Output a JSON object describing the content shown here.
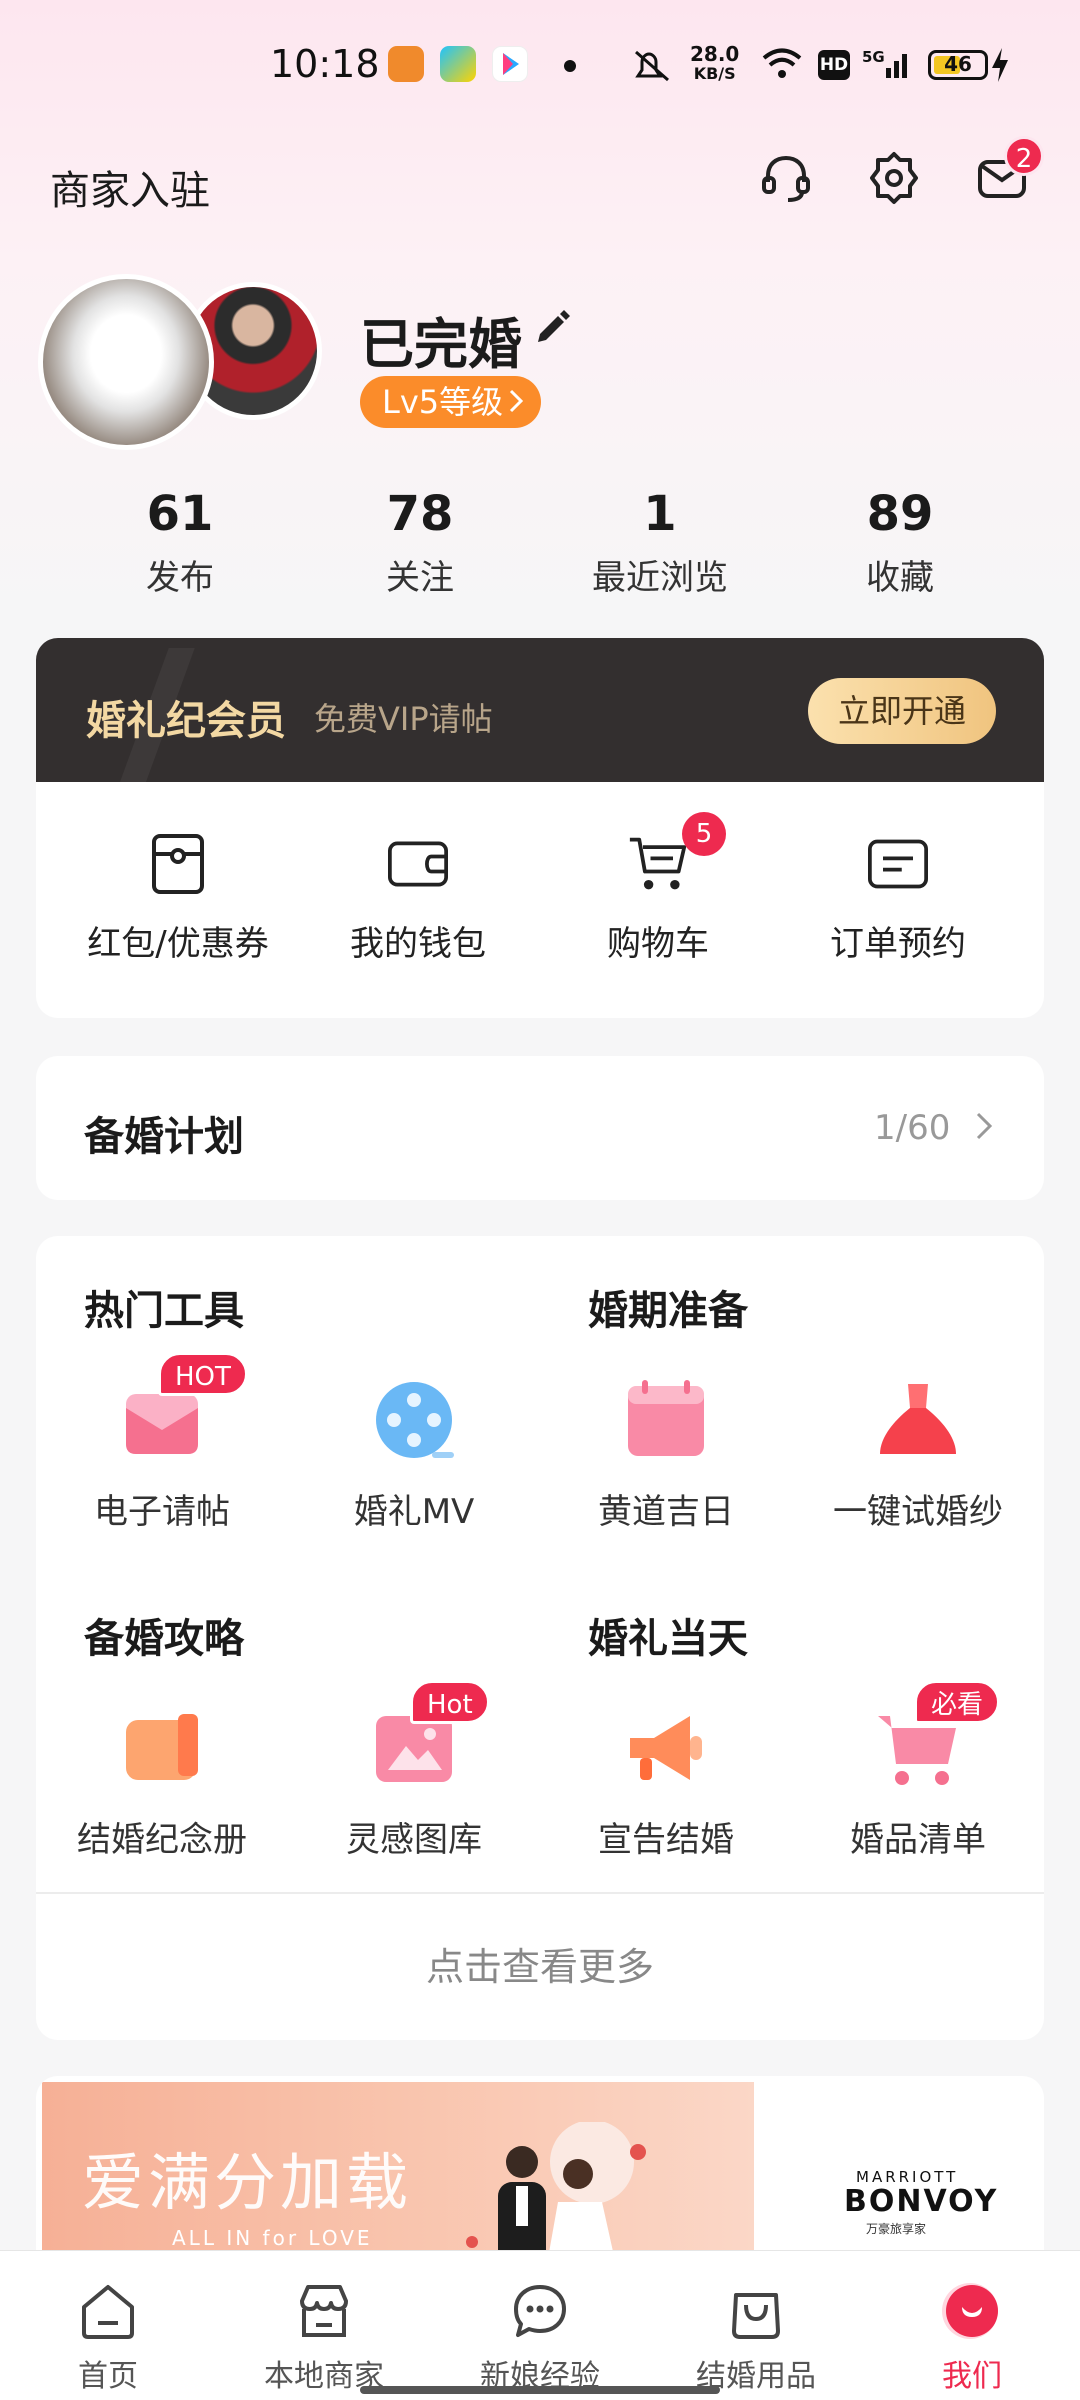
{
  "status_bar": {
    "time": "10:18",
    "net_speed_value": "28.0",
    "net_speed_unit": "KB/S",
    "hd": "HD",
    "battery": "46",
    "icons": [
      "uc-browser-icon",
      "video-app-icon",
      "youku-icon",
      "mute-icon",
      "wifi-icon",
      "5g-signal-icon",
      "charging-icon"
    ]
  },
  "header": {
    "merchant_link": "商家入驻",
    "message_badge": "2"
  },
  "profile": {
    "nickname": "已完婚",
    "level": "Lv5等级"
  },
  "stats": [
    {
      "value": "61",
      "label": "发布"
    },
    {
      "value": "78",
      "label": "关注"
    },
    {
      "value": "1",
      "label": "最近浏览"
    },
    {
      "value": "89",
      "label": "收藏"
    }
  ],
  "vip": {
    "title": "婚礼纪会员",
    "subtitle": "免费VIP请帖",
    "button": "立即开通"
  },
  "wallet": {
    "items": [
      {
        "label": "红包/优惠券",
        "icon": "coupon-icon"
      },
      {
        "label": "我的钱包",
        "icon": "wallet-icon"
      },
      {
        "label": "购物车",
        "icon": "cart-icon"
      },
      {
        "label": "订单预约",
        "icon": "order-icon"
      }
    ],
    "cart_badge": "5"
  },
  "plan": {
    "title": "备婚计划",
    "progress": "1/60"
  },
  "tools": {
    "sections": [
      {
        "title": "热门工具"
      },
      {
        "title": "婚期准备"
      },
      {
        "title": "备婚攻略"
      },
      {
        "title": "婚礼当天"
      }
    ],
    "items": [
      {
        "label": "电子请帖",
        "badge": "HOT",
        "icon": "invitation-icon"
      },
      {
        "label": "婚礼MV",
        "badge": "",
        "icon": "film-reel-icon"
      },
      {
        "label": "黄道吉日",
        "badge": "",
        "icon": "calendar-icon"
      },
      {
        "label": "一键试婚纱",
        "badge": "",
        "icon": "wedding-dress-icon"
      },
      {
        "label": "结婚纪念册",
        "badge": "",
        "icon": "album-icon"
      },
      {
        "label": "灵感图库",
        "badge": "Hot",
        "icon": "gallery-icon"
      },
      {
        "label": "宣告结婚",
        "badge": "",
        "icon": "megaphone-icon"
      },
      {
        "label": "婚品清单",
        "badge": "必看",
        "icon": "shopping-cart-icon"
      }
    ],
    "more": "点击查看更多"
  },
  "banner": {
    "title": "爱满分加载",
    "subtitle": "ALL IN for LOVE",
    "brand_top": "MARRIOTT",
    "brand_name": "BONVOY",
    "brand_sub": "万豪旅享家"
  },
  "nav": {
    "items": [
      {
        "label": "首页"
      },
      {
        "label": "本地商家"
      },
      {
        "label": "新娘经验"
      },
      {
        "label": "结婚用品"
      },
      {
        "label": "我们"
      }
    ]
  },
  "colors": {
    "accent": "#ee2a4f",
    "level_orange": "#fb8c2a",
    "vip_dark": "#332f2f",
    "vip_gold": "#f3d8a3"
  }
}
